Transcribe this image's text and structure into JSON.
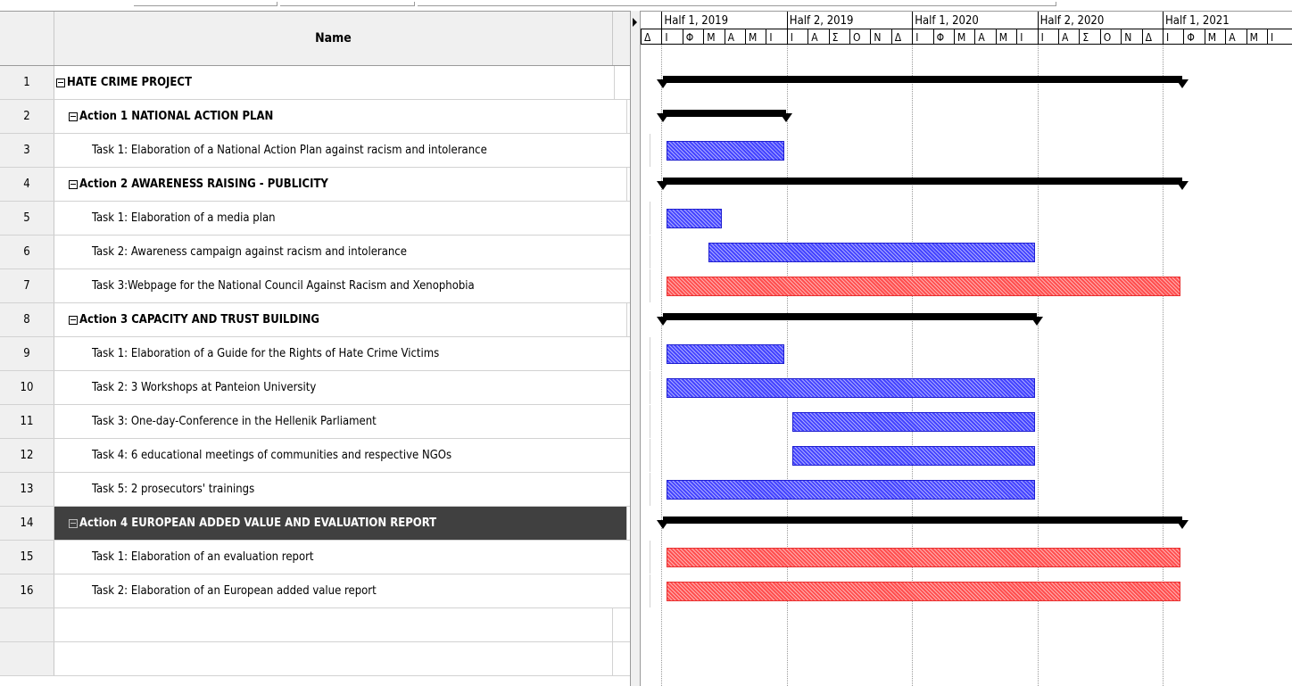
{
  "grid": {
    "name_header": "Name",
    "rows": [
      {
        "num": "1",
        "name": "HATE CRIME PROJECT"
      },
      {
        "num": "2",
        "name": "Action 1 NATIONAL ACTION PLAN"
      },
      {
        "num": "3",
        "name": "Task 1: Elaboration of a National Action Plan against racism and intolerance"
      },
      {
        "num": "4",
        "name": "Action 2 AWARENESS RAISING - PUBLICITY"
      },
      {
        "num": "5",
        "name": "Task 1: Elaboration of a media plan"
      },
      {
        "num": "6",
        "name": "Task 2: Awareness campaign against racism and intolerance"
      },
      {
        "num": "7",
        "name": "Task 3:Webpage for the National Council Against Racism and Xenophobia"
      },
      {
        "num": "8",
        "name": "Action 3 CAPACITY AND TRUST BUILDING"
      },
      {
        "num": "9",
        "name": "Task 1: Elaboration of a Guide for the Rights of Hate Crime Victims"
      },
      {
        "num": "10",
        "name": "Task 2: 3 Workshops at Panteion University"
      },
      {
        "num": "11",
        "name": "Task 3: One-day-Conference in the Hellenik Parliament"
      },
      {
        "num": "12",
        "name": "Task 4: 6 educational meetings of communities and respective NGOs"
      },
      {
        "num": "13",
        "name": "Task 5: 2 prosecutors' trainings"
      },
      {
        "num": "14",
        "name": "Action 4 EUROPEAN ADDED VALUE AND EVALUATION REPORT"
      },
      {
        "num": "15",
        "name": "Task 1: Elaboration of an evaluation report"
      },
      {
        "num": "16",
        "name": "Task 2: Elaboration of an European added value report"
      }
    ],
    "selected_row": "14"
  },
  "timeline": {
    "halves": [
      "Half 1, 2019",
      "Half 2, 2019",
      "Half 1, 2020",
      "Half 2, 2020",
      "Half 1, 2021"
    ],
    "months": [
      "Δ",
      "Ι",
      "Φ",
      "Μ",
      "Α",
      "Μ",
      "Ι",
      "Ι",
      "Α",
      "Σ",
      "Ο",
      "Ν",
      "Δ",
      "Ι",
      "Φ",
      "Μ",
      "Α",
      "Μ",
      "Ι",
      "Ι",
      "Α",
      "Σ",
      "Ο",
      "Ν",
      "Δ",
      "Ι",
      "Φ",
      "Μ",
      "Α",
      "Μ",
      "Ι"
    ]
  },
  "gantt_bars": [
    {
      "row": "1",
      "type": "summary",
      "start": "2019-01",
      "end": "2021-01"
    },
    {
      "row": "2",
      "type": "summary",
      "start": "2019-01",
      "end": "2019-06"
    },
    {
      "row": "3",
      "type": "task",
      "start": "2019-01",
      "end": "2019-06"
    },
    {
      "row": "4",
      "type": "summary",
      "start": "2019-01",
      "end": "2021-01"
    },
    {
      "row": "5",
      "type": "task",
      "start": "2019-01",
      "end": "2019-03"
    },
    {
      "row": "6",
      "type": "task",
      "start": "2019-03",
      "end": "2020-06"
    },
    {
      "row": "7",
      "type": "critical",
      "start": "2019-01",
      "end": "2021-01"
    },
    {
      "row": "8",
      "type": "summary",
      "start": "2019-01",
      "end": "2020-06"
    },
    {
      "row": "9",
      "type": "task",
      "start": "2019-01",
      "end": "2019-06"
    },
    {
      "row": "10",
      "type": "task",
      "start": "2019-01",
      "end": "2020-06"
    },
    {
      "row": "11",
      "type": "task",
      "start": "2019-07",
      "end": "2020-06"
    },
    {
      "row": "12",
      "type": "task",
      "start": "2019-07",
      "end": "2020-06"
    },
    {
      "row": "13",
      "type": "task",
      "start": "2019-01",
      "end": "2020-06"
    },
    {
      "row": "14",
      "type": "summary",
      "start": "2019-01",
      "end": "2021-01"
    },
    {
      "row": "15",
      "type": "critical",
      "start": "2019-01",
      "end": "2021-01"
    },
    {
      "row": "16",
      "type": "critical",
      "start": "2019-01",
      "end": "2021-01"
    }
  ],
  "colors": {
    "task_blue": "#4444ff",
    "critical_red": "#ff4f4f",
    "summary_black": "#000000",
    "selected_row_bg": "#404040"
  }
}
